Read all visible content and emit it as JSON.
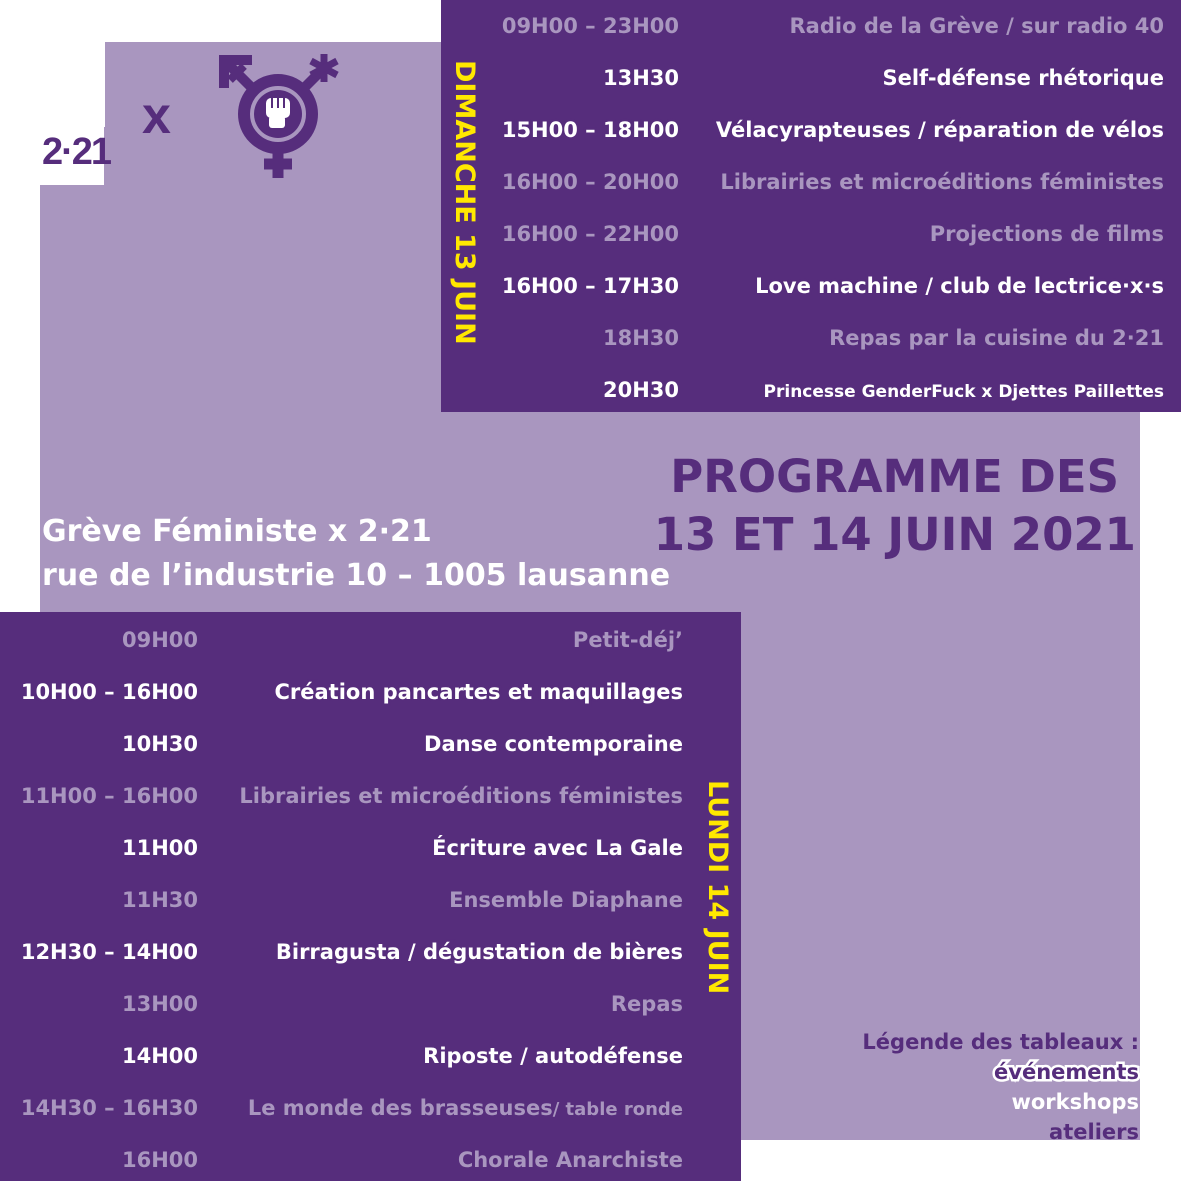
{
  "header": {
    "logo_text": "2·21",
    "cross": "x"
  },
  "sunday": {
    "day_label": "DIMANCHE 13 JUIN",
    "rows": [
      {
        "time": "09H00 – 23H00",
        "event": "Radio de la Grève / sur radio 40",
        "type": "workshop"
      },
      {
        "time": "13H30",
        "event": "Self-défense rhétorique",
        "type": "event"
      },
      {
        "time": "15H00 – 18H00",
        "event": "Vélacyrapteuses / réparation de vélos",
        "type": "atelier"
      },
      {
        "time": "16H00 – 20H00",
        "event": "Librairies et microéditions féministes",
        "type": "workshop"
      },
      {
        "time": "16H00 – 22H00",
        "event": "Projections de films",
        "type": "workshop"
      },
      {
        "time": "16H00 – 17H30",
        "event": "Love machine / club de lectrice·x·s",
        "type": "atelier"
      },
      {
        "time": "18H30",
        "event": "Repas par la cuisine du 2·21",
        "type": "workshop"
      },
      {
        "time": "20H30",
        "event": "Princesse GenderFuck x Djettes Paillettes",
        "type": "event"
      }
    ]
  },
  "title": {
    "line1": "PROGRAMME DES",
    "line2": "13 ET 14 JUIN 2021"
  },
  "address": {
    "line1": "Grève Féministe x 2·21",
    "line2": "rue de l’industrie 10 – 1005 lausanne"
  },
  "monday": {
    "day_label": "LUNDI 14 JUIN",
    "rows": [
      {
        "time": "09H00",
        "event": "Petit-déj’",
        "type": "workshop"
      },
      {
        "time": "10H00 – 16H00",
        "event": "Création pancartes et maquillages",
        "type": "atelier"
      },
      {
        "time": "10H30",
        "event": "Danse contemporaine",
        "type": "event"
      },
      {
        "time": "11H00 – 16H00",
        "event": "Librairies et microéditions féministes",
        "type": "workshop"
      },
      {
        "time": "11H00",
        "event": "Écriture avec La Gale",
        "type": "event"
      },
      {
        "time": "11H30",
        "event": "Ensemble Diaphane",
        "type": "workshop"
      },
      {
        "time": "12H30 – 14H00",
        "event": "Birragusta / dégustation de bières",
        "type": "atelier"
      },
      {
        "time": "13H00",
        "event": "Repas",
        "type": "workshop"
      },
      {
        "time": "14H00",
        "event": "Riposte / autodéfense",
        "type": "event"
      },
      {
        "time": "14H30 – 16H30",
        "event": "Le monde des brasseuses",
        "event_suffix": "/ table ronde",
        "type": "workshop"
      },
      {
        "time": "16H00",
        "event": "Chorale Anarchiste",
        "type": "workshop"
      }
    ]
  },
  "legend": {
    "title": "Légende des tableaux :",
    "events": "événements",
    "workshops": "workshops",
    "ateliers": "ateliers"
  },
  "colors": {
    "purple": "#562d7c",
    "lilac": "#a996bf",
    "yellow": "#ffe800",
    "white": "#ffffff"
  },
  "icons": [
    "feminist-fist-gender-symbol-icon"
  ]
}
